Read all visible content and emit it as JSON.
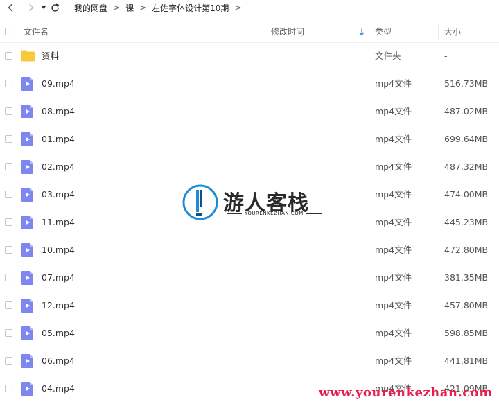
{
  "nav": {
    "back_icon": "chevron-left-icon",
    "forward_icon": "chevron-right-icon",
    "dropdown_icon": "caret-down-icon",
    "refresh_icon": "refresh-icon",
    "breadcrumbs": [
      "我的网盘",
      "课",
      "左佐字体设计第10期"
    ],
    "separator": ">"
  },
  "header": {
    "name": "文件名",
    "modified": "修改时间",
    "type": "类型",
    "size": "大小",
    "sort_icon": "arrow-down-icon"
  },
  "files": [
    {
      "name": "资料",
      "type": "文件夹",
      "size": "-",
      "icon": "folder-icon"
    },
    {
      "name": "09.mp4",
      "type": "mp4文件",
      "size": "516.73MB",
      "icon": "video-file-icon"
    },
    {
      "name": "08.mp4",
      "type": "mp4文件",
      "size": "487.02MB",
      "icon": "video-file-icon"
    },
    {
      "name": "01.mp4",
      "type": "mp4文件",
      "size": "699.64MB",
      "icon": "video-file-icon"
    },
    {
      "name": "02.mp4",
      "type": "mp4文件",
      "size": "487.32MB",
      "icon": "video-file-icon"
    },
    {
      "name": "03.mp4",
      "type": "mp4文件",
      "size": "474.00MB",
      "icon": "video-file-icon"
    },
    {
      "name": "11.mp4",
      "type": "mp4文件",
      "size": "445.23MB",
      "icon": "video-file-icon"
    },
    {
      "name": "10.mp4",
      "type": "mp4文件",
      "size": "472.80MB",
      "icon": "video-file-icon"
    },
    {
      "name": "07.mp4",
      "type": "mp4文件",
      "size": "381.35MB",
      "icon": "video-file-icon"
    },
    {
      "name": "12.mp4",
      "type": "mp4文件",
      "size": "457.80MB",
      "icon": "video-file-icon"
    },
    {
      "name": "05.mp4",
      "type": "mp4文件",
      "size": "598.85MB",
      "icon": "video-file-icon"
    },
    {
      "name": "06.mp4",
      "type": "mp4文件",
      "size": "441.81MB",
      "icon": "video-file-icon"
    },
    {
      "name": "04.mp4",
      "type": "mp4文件",
      "size": "421.09MB",
      "icon": "video-file-icon"
    }
  ],
  "watermark": {
    "title": "游人客栈",
    "subtitle": "YOURENKEZHAN.COM",
    "url": "www.yourenkezhan.com"
  },
  "colors": {
    "folder": "#f8c93a",
    "video": "#7e87f0",
    "sort_arrow": "#3a8ee6",
    "watermark_red": "#e61e4d",
    "logo_blue": "#1f8ad6"
  }
}
